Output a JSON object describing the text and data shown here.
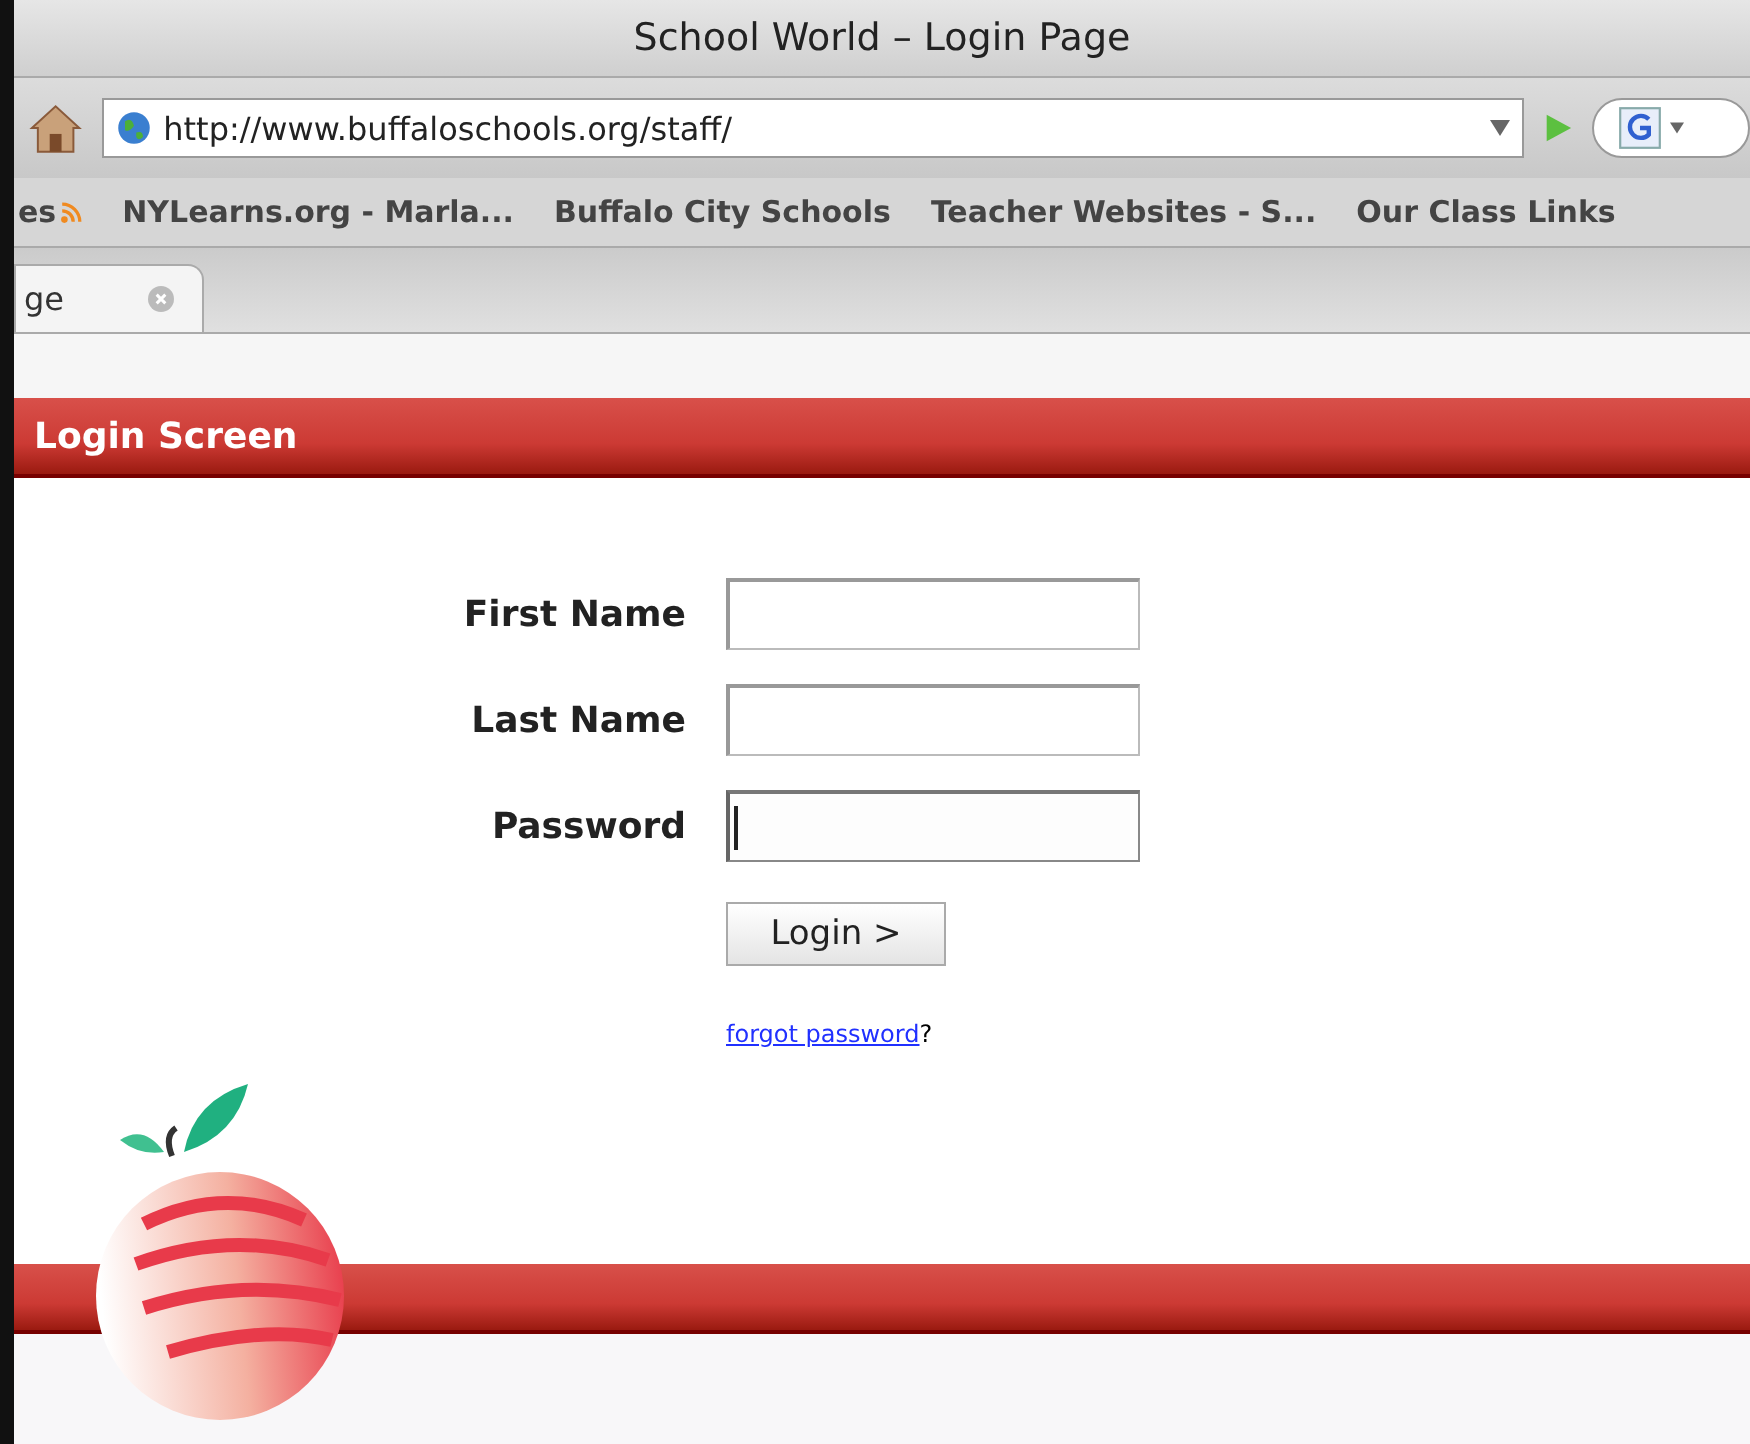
{
  "window": {
    "title": "School World – Login Page"
  },
  "toolbar": {
    "url": "http://www.buffaloschools.org/staff/"
  },
  "bookmarks": [
    {
      "label": "es",
      "kind": "feed"
    },
    {
      "label": "NYLearns.org - Marla...",
      "kind": "link"
    },
    {
      "label": "Buffalo City Schools",
      "kind": "link"
    },
    {
      "label": "Teacher Websites - S...",
      "kind": "link"
    },
    {
      "label": "Our Class Links",
      "kind": "link"
    }
  ],
  "tabs": [
    {
      "label": "ge",
      "selected": true
    }
  ],
  "header": {
    "title": "Login Screen"
  },
  "form": {
    "fields": [
      {
        "label": "First Name",
        "focused": false
      },
      {
        "label": "Last Name",
        "focused": false
      },
      {
        "label": "Password",
        "focused": true
      }
    ],
    "button": "Login >",
    "link": "forgot password",
    "link_suffix": "?"
  }
}
